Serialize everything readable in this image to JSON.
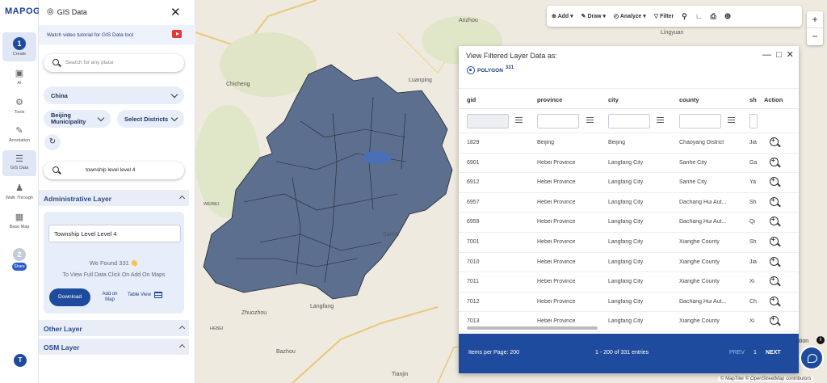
{
  "app": {
    "logo_text": "MAPOG",
    "panel_title": "GIS Data",
    "tutorial_text": "Watch video tutorial for GIS Data tool"
  },
  "rail": {
    "step1": "1",
    "create": "Create",
    "ai": "AI",
    "tools": "Tools",
    "annotation": "Annotation",
    "gis_data": "GIS Data",
    "walk": "Walk Through",
    "basemap": "Base Map",
    "step2": "2",
    "share": "Share",
    "avatar": "T"
  },
  "search": {
    "placeholder": "Search for any place"
  },
  "filters": {
    "country": "China",
    "province": "Beijing Municipality",
    "district": "Select Districts"
  },
  "layer_search": {
    "value": "township level level 4"
  },
  "admin": {
    "title": "Administrative Layer",
    "layer_name": "Township Level Level 4",
    "found": "We Found  331 👋",
    "view_full": "To View Full Data Click On Add On Maps",
    "download": "Download",
    "add_on_map": "Add on Map",
    "table_view": "Table View"
  },
  "sections": {
    "other": "Other Layer",
    "osm": "OSM Layer"
  },
  "toolbar": {
    "add": "Add",
    "draw": "Draw",
    "analyze": "Analyze",
    "filter": "Filter"
  },
  "zoom": {
    "in": "+",
    "out": "−"
  },
  "map_labels": {
    "anzhou": "Anzhou",
    "lingyuan": "Lingyuan",
    "chicheng": "Chicheng",
    "luanping": "Luanping",
    "sanhe": "Sanhe",
    "langfang": "Langfang",
    "zhuozhou": "Zhuozhou",
    "bazhou": "Bazhou",
    "tianjin": "Tianjin",
    "hebei": "HEBEI",
    "weibei": "WEIBEI"
  },
  "table": {
    "title": "View Filtered Layer Data as:",
    "polygon_label": "POLYGON",
    "polygon_count": "331",
    "columns": [
      "gid",
      "province",
      "city",
      "county",
      "sh",
      "Action"
    ],
    "rows": [
      [
        "1829",
        "Beijing",
        "Beijing",
        "Chaoyang District",
        "Jia"
      ],
      [
        "6901",
        "Hebei Province",
        "Langfang City",
        "Sanhe City",
        "Ga"
      ],
      [
        "6912",
        "Hebei Province",
        "Langfang City",
        "Sanhe City",
        "Ya"
      ],
      [
        "6957",
        "Hebei Province",
        "Langfang City",
        "Dachang Hui Aut...",
        "Sh"
      ],
      [
        "6959",
        "Hebei Province",
        "Langfang City",
        "Dachang Hui Aut...",
        "Qi"
      ],
      [
        "7001",
        "Hebei Province",
        "Langfang City",
        "Xianghe County",
        "Sh"
      ],
      [
        "7010",
        "Hebei Province",
        "Langfang City",
        "Xianghe County",
        "Jia"
      ],
      [
        "7011",
        "Hebei Province",
        "Langfang City",
        "Xianghe County",
        "Xi"
      ],
      [
        "7012",
        "Hebei Province",
        "Langfang City",
        "Dachang Hui Aut...",
        "Ch"
      ],
      [
        "7013",
        "Hebei Province",
        "Langfang City",
        "Xianghe County",
        "Xi"
      ]
    ],
    "pager": {
      "per_page": "Items per Page: 200",
      "range": "1 - 200 of 331 entries",
      "prev": "PREV",
      "page": "1",
      "next": "NEXT"
    }
  },
  "attribution": "© MapTiler © OpenStreetMap contributors",
  "attr_partial": "ution",
  "colors": {
    "accent": "#1f4b9e",
    "polygon_fill": "#5d6f8e"
  }
}
